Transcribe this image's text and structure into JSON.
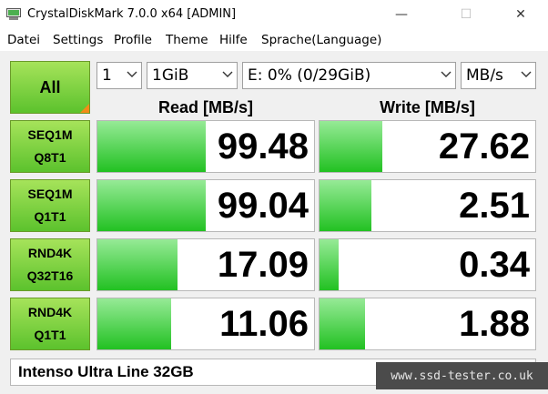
{
  "window": {
    "title": "CrystalDiskMark 7.0.0 x64 [ADMIN]",
    "minimize": "—",
    "maximize": "☐",
    "close": "✕"
  },
  "menu": [
    "Datei",
    "Settings",
    "Profile",
    "Theme",
    "Hilfe",
    "Sprache(Language)"
  ],
  "controls": {
    "all_label": "All",
    "count": "1",
    "size": "1GiB",
    "drive": "E: 0% (0/29GiB)",
    "unit": "MB/s"
  },
  "headers": {
    "read": "Read [MB/s]",
    "write": "Write [MB/s]"
  },
  "tests": [
    {
      "line1": "SEQ1M",
      "line2": "Q8T1",
      "read": "99.48",
      "write": "27.62",
      "read_fill": 0.5,
      "write_fill": 0.29
    },
    {
      "line1": "SEQ1M",
      "line2": "Q1T1",
      "read": "99.04",
      "write": "2.51",
      "read_fill": 0.5,
      "write_fill": 0.24
    },
    {
      "line1": "RND4K",
      "line2": "Q32T16",
      "read": "17.09",
      "write": "0.34",
      "read_fill": 0.37,
      "write_fill": 0.09
    },
    {
      "line1": "RND4K",
      "line2": "Q1T1",
      "read": "11.06",
      "write": "1.88",
      "read_fill": 0.34,
      "write_fill": 0.21
    }
  ],
  "comment": "Intenso Ultra Line 32GB",
  "watermark": "www.ssd-tester.co.uk",
  "colors": {
    "accent_green": "#5cc22d",
    "bar_green": "#22c122",
    "corner_orange": "#f28c18"
  }
}
